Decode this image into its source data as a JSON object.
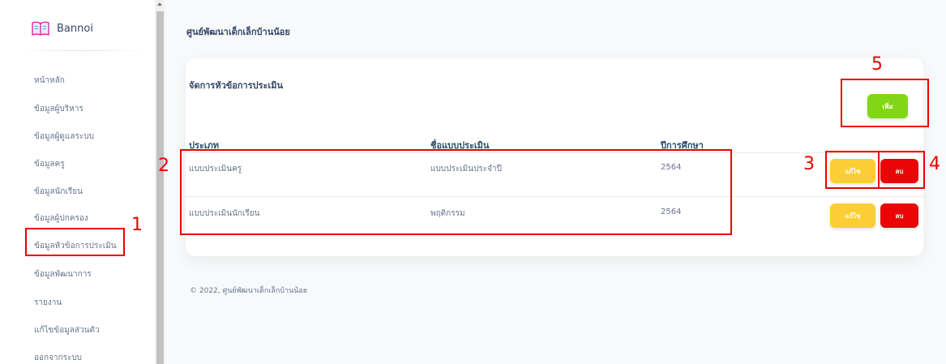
{
  "brand": {
    "name": "Bannoi"
  },
  "nav": [
    {
      "label": "หน้าหลัก"
    },
    {
      "label": "ข้อมูลผู้บริหาร"
    },
    {
      "label": "ข้อมูลผู้ดูแลระบบ"
    },
    {
      "label": "ข้อมูลครู"
    },
    {
      "label": "ข้อมูลนักเรียน"
    },
    {
      "label": "ข้อมูลผู้ปกครอง"
    },
    {
      "label": "ข้อมูลหัวข้อการประเมิน"
    },
    {
      "label": "ข้อมูลพัฒนาการ"
    },
    {
      "label": "รายงาน"
    },
    {
      "label": "แก้ไขข้อมูลส่วนตัว"
    },
    {
      "label": "ออกจากระบบ"
    }
  ],
  "page_title": "ศูนย์พัฒนาเด็กเล็กบ้านน้อย",
  "card": {
    "title": "จัดการหัวข้อการประเมิน",
    "add_label": "เพิ่ม",
    "columns": [
      "ประเภท",
      "ชื่อแบบประเมิน",
      "ปีการศึกษา"
    ],
    "rows": [
      {
        "type": "แบบประเมินครู",
        "name": "แบบประเมินประจำปี",
        "year": "2564",
        "edit_label": "แก้ไข",
        "delete_label": "ลบ"
      },
      {
        "type": "แบบประเมินนักเรียน",
        "name": "พฤติกรรม",
        "year": "2564",
        "edit_label": "แก้ไข",
        "delete_label": "ลบ"
      }
    ]
  },
  "footer": "© 2022, ศูนย์พัฒนาเด็กเล็กบ้านน้อย",
  "annotations": [
    "1",
    "2",
    "3",
    "4",
    "5"
  ],
  "colors": {
    "add": "#82d616",
    "edit": "#fbcf33",
    "delete": "#ea0606",
    "annotation": "#ee0000",
    "text": "#344767",
    "muted": "#67748e"
  }
}
